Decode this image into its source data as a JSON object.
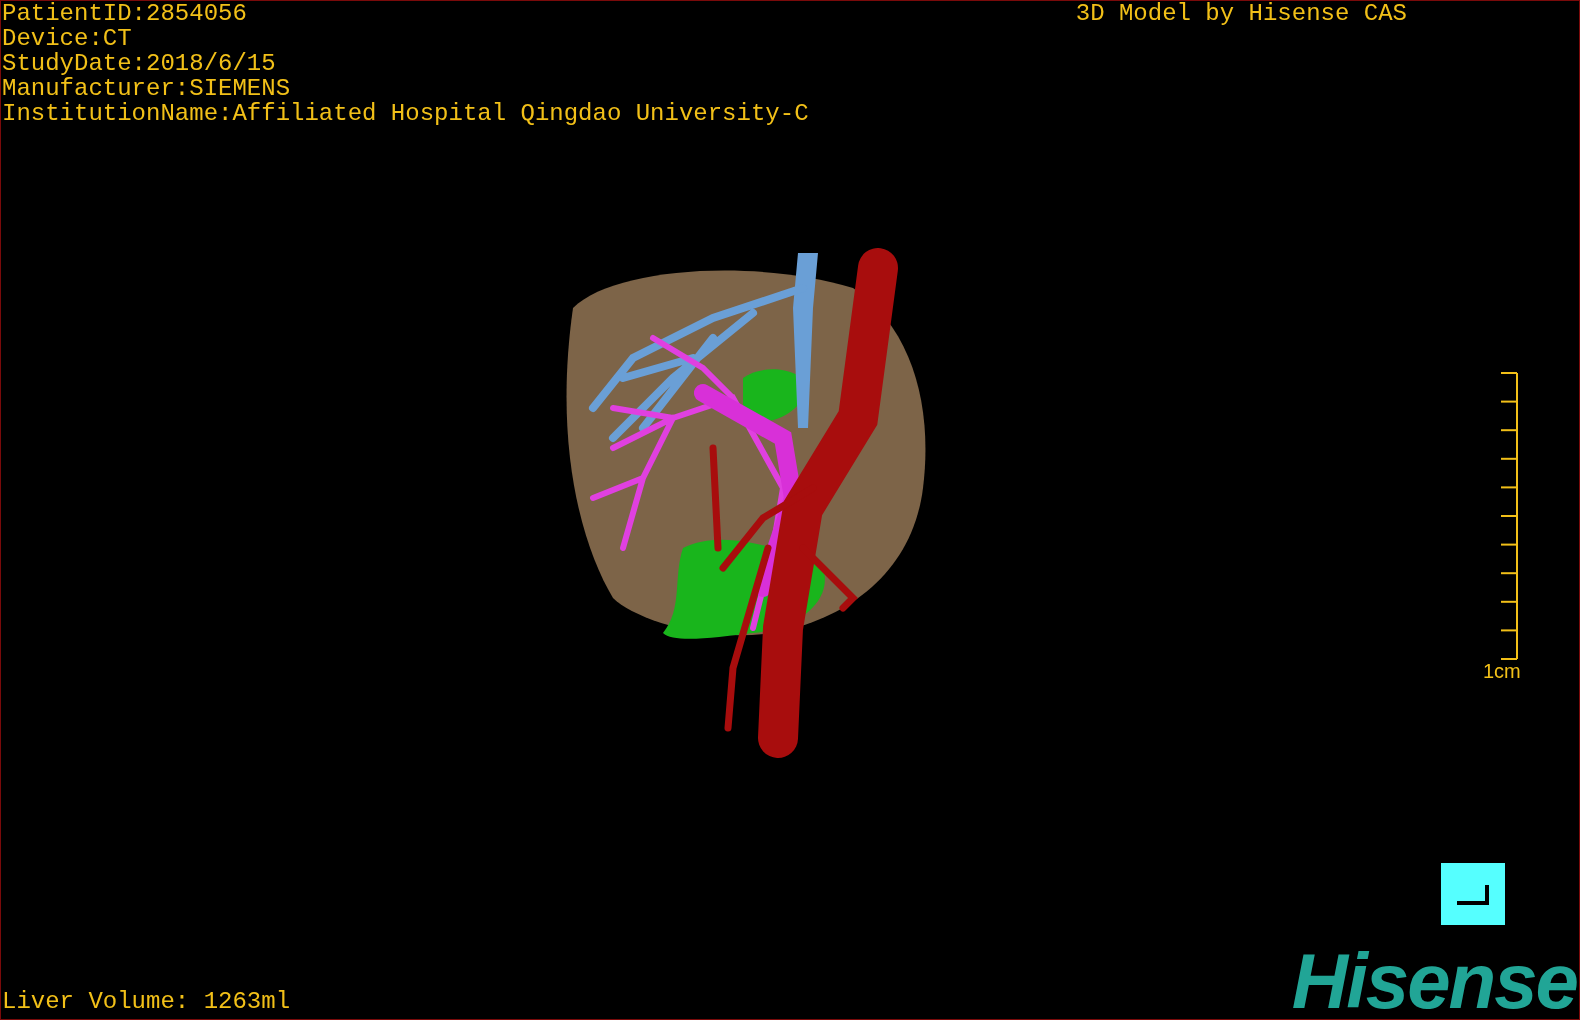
{
  "header": {
    "info_lines": [
      "PatientID:2854056",
      "Device:CT",
      "StudyDate:2018/6/15",
      "Manufacturer:SIEMENS",
      "InstitutionName:Affiliated Hospital Qingdao University-C"
    ],
    "brand": "3D Model by Hisense CAS"
  },
  "scale_bar": {
    "label": "1cm"
  },
  "liver_volume": "Liver Volume: 1263ml",
  "logo": "Hisense"
}
